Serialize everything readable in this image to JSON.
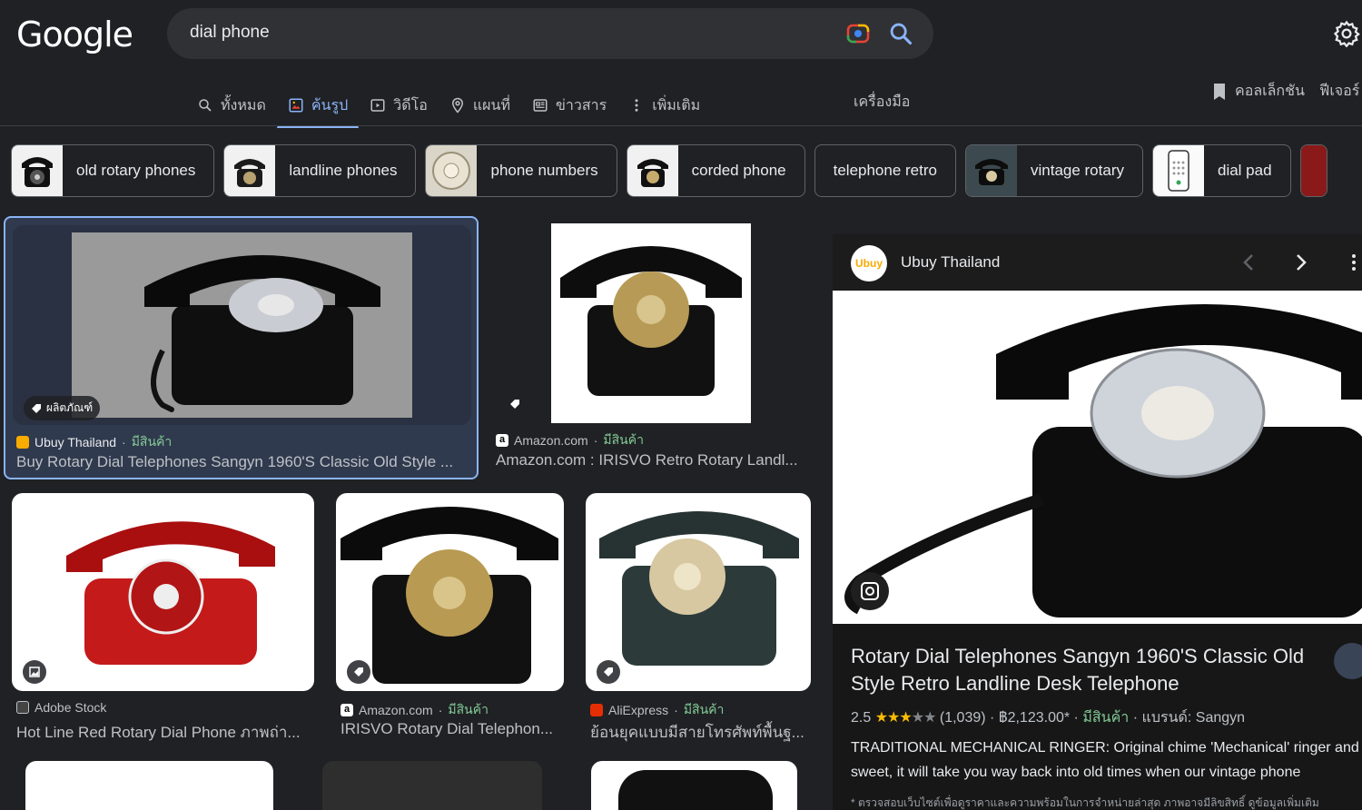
{
  "header": {
    "logo": "Google",
    "query": "dial phone"
  },
  "tabs": [
    {
      "label": "ทั้งหมด",
      "icon": "search-icon"
    },
    {
      "label": "ค้นรูป",
      "icon": "image-icon",
      "active": true
    },
    {
      "label": "วิดีโอ",
      "icon": "video-icon"
    },
    {
      "label": "แผนที่",
      "icon": "map-pin-icon"
    },
    {
      "label": "ข่าวสาร",
      "icon": "news-icon"
    },
    {
      "label": "เพิ่มเติม",
      "icon": "more-vert-icon"
    }
  ],
  "tools": "เครื่องมือ",
  "collections": "คอลเล็กชัน",
  "featured": "ฟีเจอร์",
  "chips": [
    {
      "label": "old rotary phones",
      "has_thumb": true
    },
    {
      "label": "landline phones",
      "has_thumb": true
    },
    {
      "label": "phone numbers",
      "has_thumb": true
    },
    {
      "label": "corded phone",
      "has_thumb": true
    },
    {
      "label": "telephone retro",
      "has_thumb": false
    },
    {
      "label": "vintage rotary",
      "has_thumb": true
    },
    {
      "label": "dial pad",
      "has_thumb": true
    }
  ],
  "results": [
    {
      "site": "Ubuy Thailand",
      "stock": "มีสินค้า",
      "title": "Buy Rotary Dial Telephones Sangyn 1960'S Classic Old Style ...",
      "badge": "ผลิตภัณฑ์"
    },
    {
      "site": "Amazon.com",
      "stock": "มีสินค้า",
      "title": "Amazon.com : IRISVO Retro Rotary Landl..."
    },
    {
      "site": "Adobe Stock",
      "stock": "",
      "title": "Hot Line Red Rotary Dial Phone ภาพถ่า..."
    },
    {
      "site": "Amazon.com",
      "stock": "มีสินค้า",
      "title": "IRISVO Rotary Dial Telephon..."
    },
    {
      "site": "AliExpress",
      "stock": "มีสินค้า",
      "title": "ย้อนยุคแบบมีสายโทรศัพท์พื้นฐ..."
    }
  ],
  "panel": {
    "site": "Ubuy Thailand",
    "favicon_text": "Ubuy",
    "title": "Rotary Dial Telephones Sangyn 1960'S Classic Old Style Retro Landline Desk Telephone",
    "rating": "2.5",
    "rating_stars": 2.5,
    "reviews": "(1,039)",
    "price": "฿2,123.00*",
    "stock": "มีสินค้า",
    "brand": "แบรนด์: Sangyn",
    "description": "TRADITIONAL MECHANICAL RINGER: Original chime 'Mechanical' ringer and sweet, it will take you way back into old times when our vintage phone",
    "note": "* ตรวจสอบเว็บไซต์เพื่อดูราคาและความพร้อมในการจำหน่ายล่าสุด ภาพอาจมีลิขสิทธิ์ ดูข้อมูลเพิ่มเติม"
  },
  "colors": {
    "background": "#202124",
    "accent": "#8ab4f8",
    "stock": "#81c995",
    "star": "#fbbc04"
  }
}
